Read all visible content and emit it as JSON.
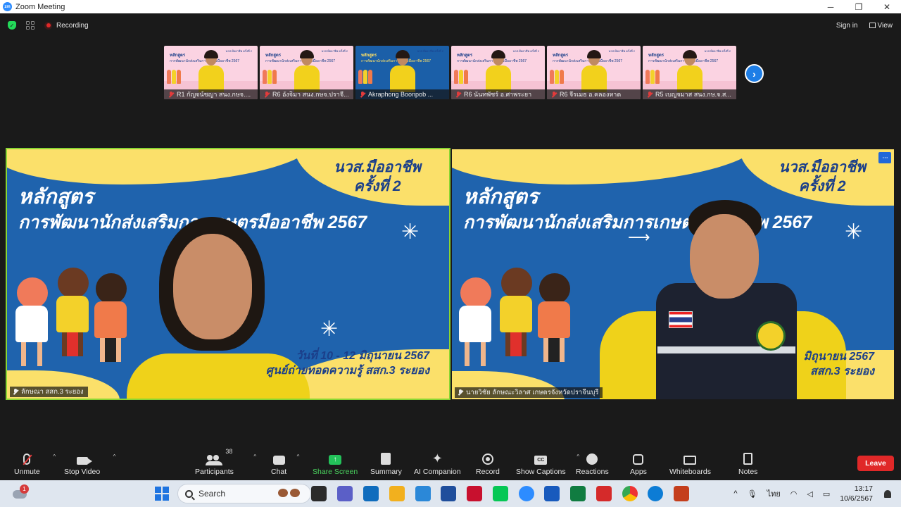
{
  "window": {
    "title": "Zoom Meeting",
    "app_icon": "zm",
    "minimize": "─",
    "maximize": "❐",
    "close": "✕"
  },
  "topbar": {
    "recording_label": "Recording",
    "sign_in": "Sign in",
    "view": "View"
  },
  "thumbnails": [
    {
      "name": "R1 กัญจน์ชญา สนง.กษจ....",
      "style": "pink",
      "muted": true
    },
    {
      "name": "R6 อังจิมา สนง.กษจ.ปราจี...",
      "style": "pink",
      "muted": true
    },
    {
      "name": "Akraphong Boonpob ...",
      "style": "blue",
      "muted": true
    },
    {
      "name": "R6 นันทพัชร์ อ.ศาพระยา",
      "style": "pink",
      "muted": true
    },
    {
      "name": "R6 จีรเมธ อ.คลองหาด",
      "style": "pink",
      "muted": true
    },
    {
      "name": "R5 เบญจมาส สนง.กษ.จ.ส...",
      "style": "pink",
      "muted": true
    }
  ],
  "thumb_slide": {
    "title": "หลักสูตร",
    "subtitle": "การพัฒนานักส่งเสริมการเกษตรมืออาชีพ 2567",
    "corner": "นวส.มืออาชีพ ครั้งที่ 2"
  },
  "next_page": "›",
  "slide": {
    "badge_line1": "นวส.มืออาชีพ",
    "badge_line2": "ครั้งที่ 2",
    "title": "หลักสูตร",
    "subtitle": "การพัฒนานักส่งเสริมการเกษตรมืออาชีพ 2567",
    "date_line1": "วันที่ 10 - 12 มิถุนายน 2567",
    "date_line2": "ศูนย์ถ่ายทอดความรู้ สสก.3 ระยอง",
    "date_line1_right": "มิถุนายน 2567",
    "date_line2_right": "สสก.3 ระยอง"
  },
  "videos": {
    "left_name": "ลักษณา สสก.3 ระยอง",
    "right_name": "นายวิชัย ลักษณะวิลาศ เกษตรจังหวัดปราจีนบุรี",
    "more": "···"
  },
  "toolbar": {
    "unmute": "Unmute",
    "stop_video": "Stop Video",
    "participants": "Participants",
    "participants_count": "38",
    "chat": "Chat",
    "share_screen": "Share Screen",
    "summary": "Summary",
    "ai_companion": "AI Companion",
    "record": "Record",
    "show_captions": "Show Captions",
    "reactions": "Reactions",
    "apps": "Apps",
    "whiteboards": "Whiteboards",
    "notes": "Notes",
    "leave": "Leave",
    "caret": "^"
  },
  "taskbar": {
    "search": "Search",
    "notification_count": "1",
    "language": "ไทย",
    "time": "13:17",
    "date": "10/6/2567",
    "chevron": "^"
  },
  "colors": {
    "accent_green": "#23d959",
    "share_green": "#23c25a",
    "leave_red": "#e02828",
    "slide_blue": "#1f63ad",
    "slide_yellow": "#fbe06a",
    "active_border": "#8ad633"
  }
}
